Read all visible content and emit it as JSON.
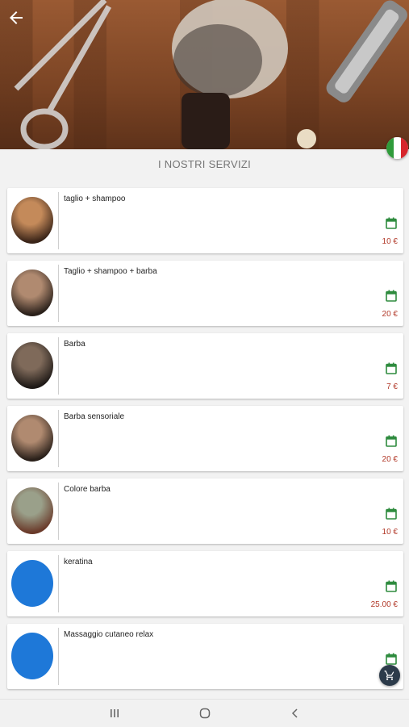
{
  "header": {
    "back_icon": "arrow-left-icon",
    "language_flag": "italy-flag-icon"
  },
  "section": {
    "title": "I NOSTRI SERVIZI"
  },
  "services": [
    {
      "name": "taglio + shampoo",
      "price": "10 €",
      "thumb": "photo",
      "tone": [
        "#c48a5a",
        "#3a2418"
      ]
    },
    {
      "name": "Taglio + shampoo + barba",
      "price": "20 €",
      "thumb": "photo",
      "tone": [
        "#b08a70",
        "#2a201a"
      ]
    },
    {
      "name": "Barba",
      "price": "7 €",
      "thumb": "photo",
      "tone": [
        "#7f6a5a",
        "#1f1a17"
      ]
    },
    {
      "name": "Barba sensoriale",
      "price": "20 €",
      "thumb": "photo",
      "tone": [
        "#b08a70",
        "#2a201a"
      ]
    },
    {
      "name": "Colore barba",
      "price": "10 €",
      "thumb": "photo",
      "tone": [
        "#9aa08a",
        "#6a3a2a"
      ]
    },
    {
      "name": "keratina",
      "price": "25.00 €",
      "thumb": "placeholder",
      "tone": [
        "#1e78d8",
        "#1e78d8"
      ]
    },
    {
      "name": "Massaggio cutaneo relax",
      "price": "",
      "thumb": "placeholder",
      "tone": [
        "#1e78d8",
        "#1e78d8"
      ]
    }
  ],
  "colors": {
    "calendar": "#2e8b3e",
    "price": "#b23a2a",
    "placeholder": "#1e78d8",
    "fab": "#2c3b4a"
  },
  "fab": {
    "icon": "cart-icon"
  },
  "system_nav": {
    "recents_icon": "recents-icon",
    "home_icon": "home-icon",
    "back_icon": "back-chevron-icon"
  }
}
